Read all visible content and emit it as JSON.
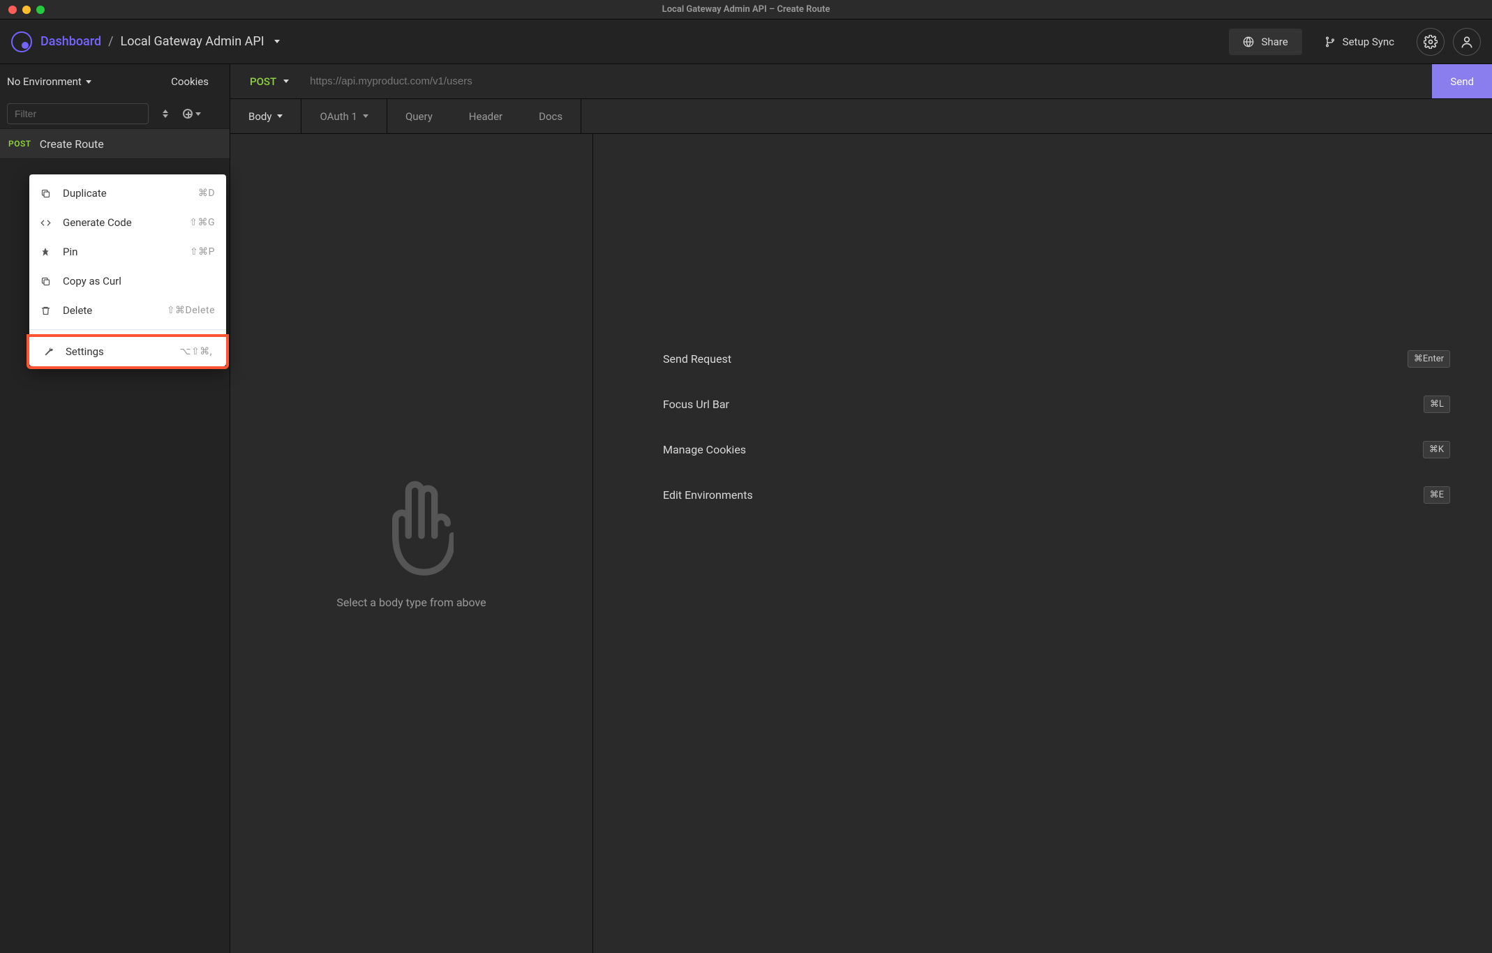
{
  "window": {
    "title": "Local Gateway Admin API – Create Route"
  },
  "header": {
    "workspace": "Dashboard",
    "separator": "/",
    "project": "Local Gateway Admin API",
    "share": "Share",
    "setup_sync": "Setup Sync"
  },
  "sidebar": {
    "environment": "No Environment",
    "cookies": "Cookies",
    "filter_placeholder": "Filter",
    "requests": [
      {
        "method": "POST",
        "name": "Create Route"
      }
    ]
  },
  "context_menu": {
    "items": [
      {
        "id": "duplicate",
        "label": "Duplicate",
        "shortcut": "⌘D",
        "icon": "copy",
        "highlighted": false
      },
      {
        "id": "generate-code",
        "label": "Generate Code",
        "shortcut": "⇧⌘G",
        "icon": "code",
        "highlighted": false
      },
      {
        "id": "pin",
        "label": "Pin",
        "shortcut": "⇧⌘P",
        "icon": "pin",
        "highlighted": false
      },
      {
        "id": "copy-curl",
        "label": "Copy as Curl",
        "shortcut": "",
        "icon": "copy",
        "highlighted": false
      },
      {
        "id": "delete",
        "label": "Delete",
        "shortcut": "⇧⌘Delete",
        "icon": "trash",
        "highlighted": false
      },
      {
        "id": "settings",
        "label": "Settings",
        "shortcut": "⌥⇧⌘,",
        "icon": "wrench",
        "highlighted": true
      }
    ]
  },
  "request": {
    "method": "POST",
    "url_placeholder": "https://api.myproduct.com/v1/users",
    "url": "",
    "send": "Send",
    "tabs": [
      {
        "id": "body",
        "label": "Body",
        "caret": true,
        "active": true
      },
      {
        "id": "auth",
        "label": "OAuth 1",
        "caret": true,
        "active": false
      },
      {
        "id": "query",
        "label": "Query",
        "caret": false,
        "active": false
      },
      {
        "id": "header",
        "label": "Header",
        "caret": false,
        "active": false
      },
      {
        "id": "docs",
        "label": "Docs",
        "caret": false,
        "active": false
      }
    ],
    "body_placeholder": "Select a body type from above"
  },
  "cheatsheet": [
    {
      "label": "Send Request",
      "shortcut": "⌘Enter"
    },
    {
      "label": "Focus Url Bar",
      "shortcut": "⌘L"
    },
    {
      "label": "Manage Cookies",
      "shortcut": "⌘K"
    },
    {
      "label": "Edit Environments",
      "shortcut": "⌘E"
    }
  ]
}
